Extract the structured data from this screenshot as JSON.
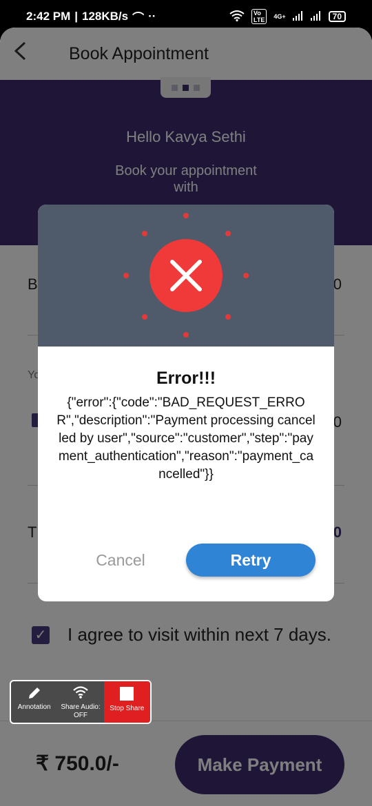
{
  "status_bar": {
    "time": "2:42 PM",
    "network_speed": "128KB/s",
    "network_type": "4G+",
    "battery": "70"
  },
  "app_bar": {
    "title": "Book Appointment"
  },
  "hero": {
    "greeting": "Hello Kavya Sethi",
    "subtitle_line1": "Book your appointment",
    "subtitle_line2": "with"
  },
  "content": {
    "row1_label": "B",
    "row1_value": "0",
    "row2_label": "Yo",
    "row2_value": "50",
    "row3_label": "T",
    "row3_value": "0",
    "agree_text": "I agree to visit within next 7 days."
  },
  "footer": {
    "price": "₹ 750.0/-",
    "pay_button": "Make Payment"
  },
  "share_toolbar": {
    "annotation": "Annotation",
    "share_audio": "Share Audio:",
    "share_audio_state": "OFF",
    "stop_share": "Stop Share"
  },
  "dialog": {
    "title": "Error!!!",
    "message": "{\"error\":{\"code\":\"BAD_REQUEST_ERROR\",\"description\":\"Payment processing cancelled by user\",\"source\":\"customer\",\"step\":\"payment_authentication\",\"reason\":\"payment_cancelled\"}}",
    "cancel_label": "Cancel",
    "retry_label": "Retry"
  },
  "colors": {
    "primary_purple": "#3d2a6e",
    "error_red": "#f03a3a",
    "retry_blue": "#2f84d6",
    "dialog_header": "#4f5b6b"
  }
}
